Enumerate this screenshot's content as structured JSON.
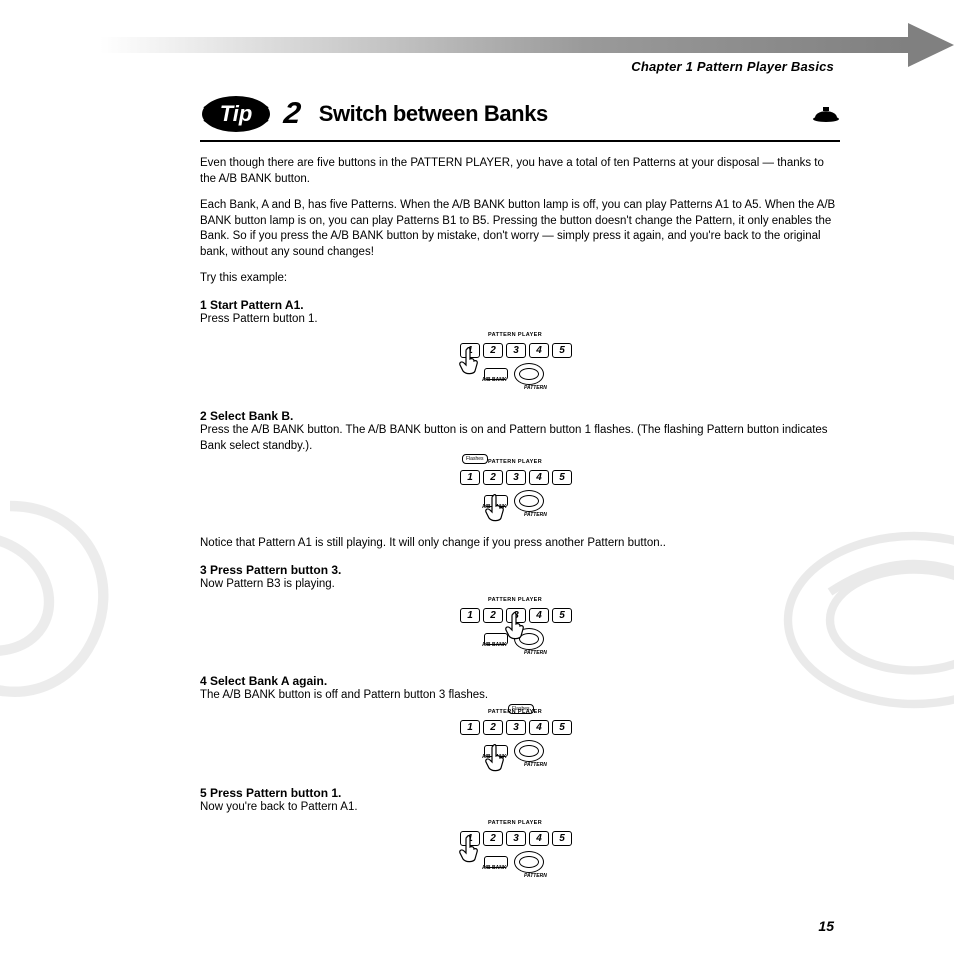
{
  "chapter": "Chapter 1 Pattern Player Basics",
  "tip": {
    "badge_text": "Tip",
    "number": "2",
    "title": "Switch between Banks",
    "difficulty_icon": "hard-hat-icon"
  },
  "intro": [
    "Even though there are five buttons in the PATTERN PLAYER, you have a total of ten Patterns at your disposal — thanks to the A/B BANK button.",
    "Each Bank, A and B, has five Patterns.  When the A/B BANK button lamp is off, you can play Patterns A1 to A5.  When the A/B BANK button lamp is on, you can play Patterns B1 to B5.  Pressing the button doesn't change the Pattern, it only enables the Bank.  So if you press the A/B BANK button by mistake, don't worry — simply press it again, and you're back to the original bank, without any sound changes!",
    "Try this example:"
  ],
  "steps": [
    {
      "heading": "1  Start Pattern A1.",
      "body": "Press Pattern button 1.",
      "diagram": {
        "hand_on": "button-1",
        "flashes": false
      }
    },
    {
      "heading": "2  Select Bank B.",
      "body": "Press the A/B BANK button.  The A/B BANK button is on and Pattern button 1 flashes.  (The flashing Pattern button indicates Bank select standby.).",
      "diagram": {
        "hand_on": "ab-bank",
        "flashes": true,
        "flash_button": 1
      },
      "after": "Notice that Pattern A1 is still playing.  It will only change if you press another Pattern button.."
    },
    {
      "heading": "3  Press Pattern button 3.",
      "body": "Now Pattern B3 is playing.",
      "diagram": {
        "hand_on": "button-3",
        "flashes": false
      }
    },
    {
      "heading": "4  Select Bank A again.",
      "body": "The A/B BANK button is off and Pattern button 3 flashes.",
      "diagram": {
        "hand_on": "ab-bank",
        "flashes": true,
        "flash_button": 3
      }
    },
    {
      "heading": "5  Press Pattern button 1.",
      "body": "Now you're back to Pattern A1.",
      "diagram": {
        "hand_on": "button-1",
        "flashes": false
      }
    }
  ],
  "diagram_labels": {
    "top": "PATTERN PLAYER",
    "buttons": [
      "1",
      "2",
      "3",
      "4",
      "5"
    ],
    "ab_bank": "A/B BANK",
    "pattern": "PATTERN",
    "flashes": "Flashes"
  },
  "page_number": "15"
}
